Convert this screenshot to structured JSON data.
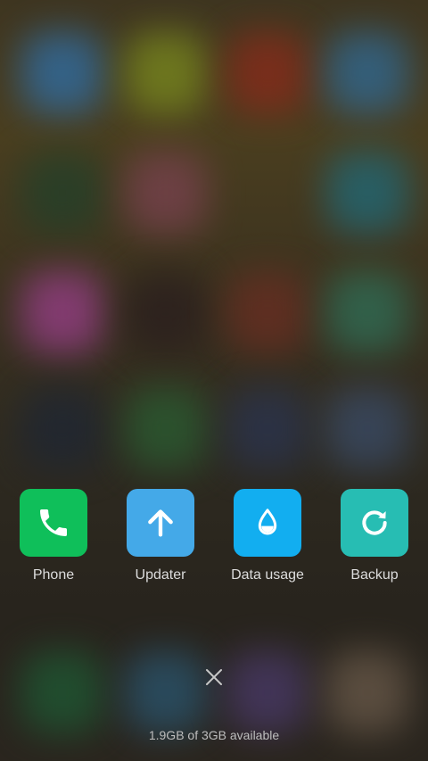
{
  "recents": {
    "apps": [
      {
        "label": "Phone",
        "icon": "phone-icon",
        "color": "#0fbf5a"
      },
      {
        "label": "Updater",
        "icon": "arrow-up-icon",
        "color": "#44a9e8"
      },
      {
        "label": "Data usage",
        "icon": "water-drop-icon",
        "color": "#12aef0"
      },
      {
        "label": "Backup",
        "icon": "refresh-circle-icon",
        "color": "#27bdb3"
      }
    ],
    "close_icon": "close-icon",
    "memory_status": "1.9GB of 3GB available"
  },
  "colors": {
    "label_text": "#dcdcdc",
    "memory_text": "#bdbdbd"
  }
}
